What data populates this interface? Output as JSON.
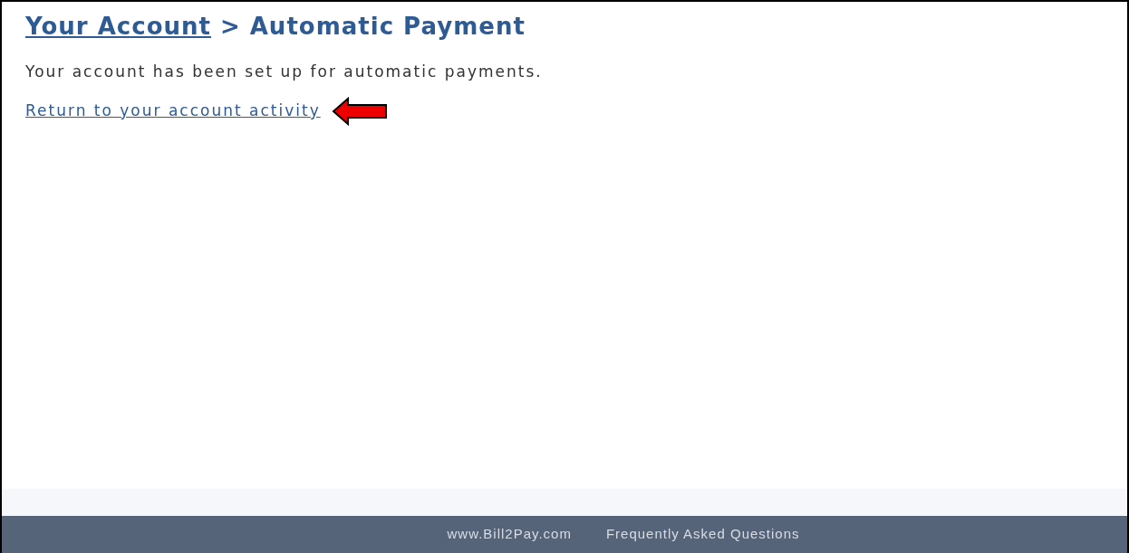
{
  "heading": {
    "link": "Your Account",
    "separator": ">",
    "title": "Automatic Payment"
  },
  "message": "Your account has been set up for automatic payments.",
  "return_link": "Return to your account activity",
  "footer": {
    "links": [
      "www.Bill2Pay.com",
      "Frequently Asked Questions"
    ]
  }
}
